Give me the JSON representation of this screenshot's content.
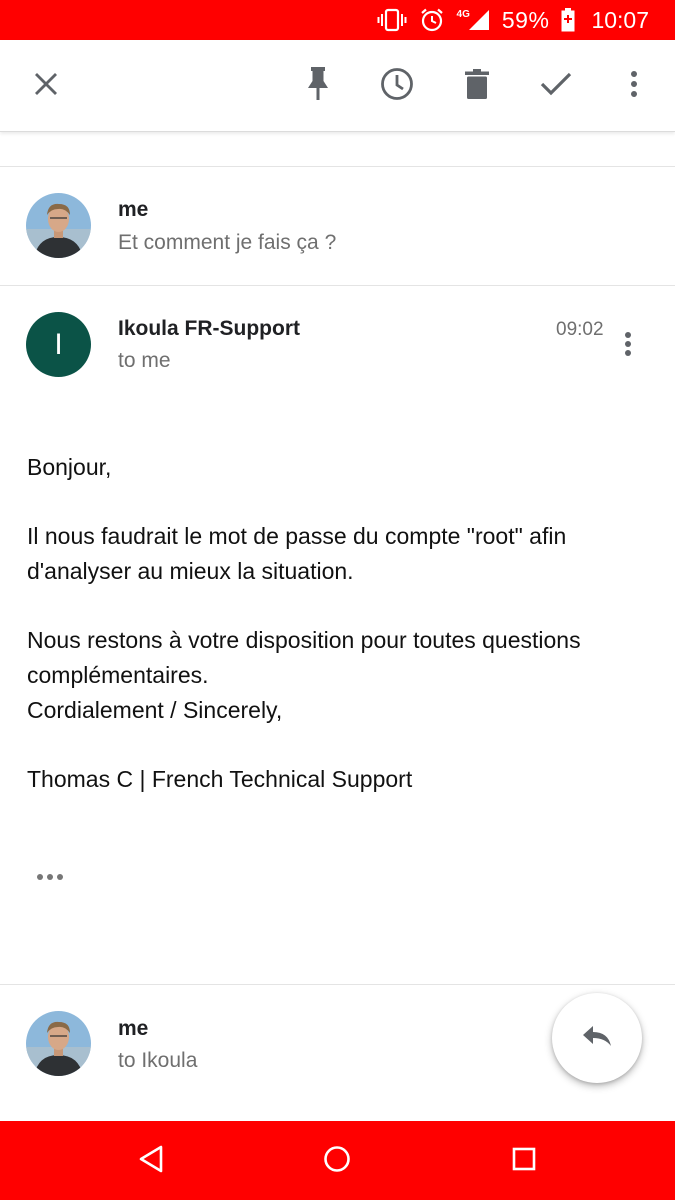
{
  "status_bar": {
    "icons": [
      "vibrate-icon",
      "alarm-icon",
      "signal-4g-icon",
      "battery-icon"
    ],
    "network_label": "4G",
    "battery_percent": "59%",
    "time": "10:07",
    "background_color": "#ff0000"
  },
  "toolbar": {
    "icons": [
      "close-icon",
      "pin-icon",
      "snooze-icon",
      "delete-icon",
      "done-icon",
      "more-vert-icon"
    ]
  },
  "thread": {
    "collapsed_message": {
      "sender": "me",
      "snippet": "Et comment je fais ça ?"
    },
    "open_message": {
      "avatar_letter": "I",
      "avatar_color": "#0b5347",
      "sender": "Ikoula FR-Support",
      "recipient": "to me",
      "time": "09:02",
      "body": {
        "greeting": "Bonjour,",
        "paragraph1": "Il nous faudrait le mot de passe du compte \"root\" afin d'analyser au mieux la situation.",
        "paragraph2": "Nous restons à votre disposition pour toutes questions complémentaires.",
        "closing": "Cordialement / Sincerely,",
        "signature": "Thomas C | French Technical Support"
      }
    },
    "draft_message": {
      "sender": "me",
      "recipient": "to Ikoula"
    }
  },
  "fab": {
    "icon": "reply-icon"
  },
  "nav_bar": {
    "icons": [
      "back-icon",
      "home-icon",
      "recents-icon"
    ],
    "background_color": "#ff0000"
  }
}
